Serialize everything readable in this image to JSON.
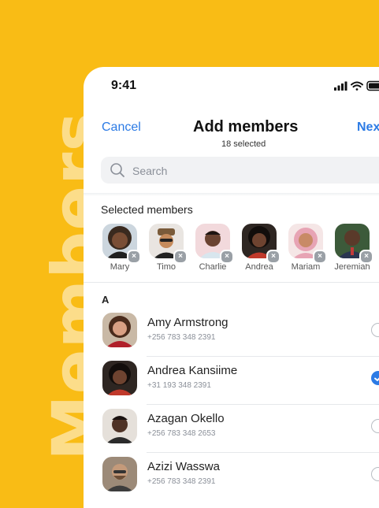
{
  "background_word": "Members",
  "colors": {
    "accent": "#2C7BE5",
    "background": "#F9BC15",
    "background_text": "#FCDD8A"
  },
  "status_bar": {
    "time": "9:41",
    "icons": [
      "signal-icon",
      "wifi-icon",
      "battery-icon"
    ]
  },
  "nav": {
    "cancel_label": "Cancel",
    "title": "Add members",
    "subtitle": "18 selected",
    "next_label": "Next"
  },
  "search": {
    "placeholder": "Search",
    "value": ""
  },
  "selected_members": {
    "label": "Selected members",
    "items": [
      {
        "name": "Mary"
      },
      {
        "name": "Timo"
      },
      {
        "name": "Charlie"
      },
      {
        "name": "Andrea"
      },
      {
        "name": "Mariam"
      },
      {
        "name": "Jeremiah"
      }
    ]
  },
  "contacts": {
    "section": "A",
    "items": [
      {
        "name": "Amy Armstrong",
        "phone": "+256 783 348 2391",
        "selected": false
      },
      {
        "name": "Andrea Kansiime",
        "phone": "+31 193 348 2391",
        "selected": true
      },
      {
        "name": "Azagan Okello",
        "phone": "+256 783 348 2653",
        "selected": false
      },
      {
        "name": "Azizi Wasswa",
        "phone": "+256 783 348 2391",
        "selected": false
      }
    ]
  }
}
